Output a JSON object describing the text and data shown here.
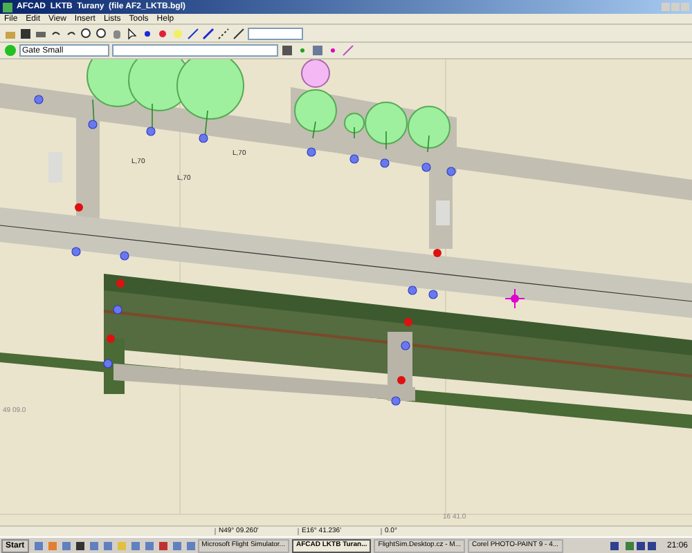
{
  "window": {
    "title": "AFCAD  LKTB  Turany  (file AF2_LKTB.bgl)"
  },
  "menu": [
    "File",
    "Edit",
    "View",
    "Insert",
    "Lists",
    "Tools",
    "Help"
  ],
  "object_type": {
    "value": "Gate Small"
  },
  "map": {
    "labels": [
      {
        "kind": "gate",
        "text": "L,70"
      },
      {
        "kind": "gate",
        "text": "L,70"
      },
      {
        "kind": "gate",
        "text": "L,70"
      },
      {
        "kind": "grid",
        "text": "49 09.0"
      },
      {
        "kind": "grid",
        "text": "16 41.0"
      }
    ]
  },
  "status_bar": [
    "N49° 09.260'",
    "E16° 41.236'",
    "0.0°"
  ],
  "taskbar": {
    "start": "Start",
    "tasks": [
      {
        "label": "Microsoft Flight Simulator...",
        "selected": false
      },
      {
        "label": "AFCAD  LKTB  Turan...",
        "selected": true
      },
      {
        "label": "FlightSim.Desktop.cz - M...",
        "selected": false
      },
      {
        "label": "Corel PHOTO-PAINT 9 - 4...",
        "selected": false
      }
    ],
    "clock": "21:06"
  }
}
